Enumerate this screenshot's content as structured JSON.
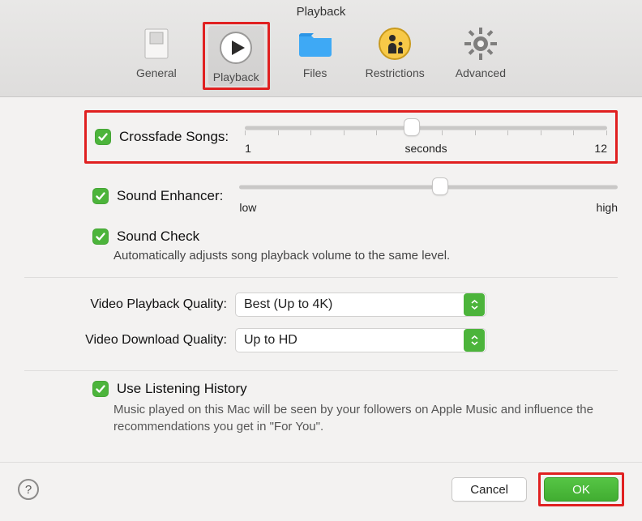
{
  "title": "Playback",
  "tabs": {
    "general": "General",
    "playback": "Playback",
    "files": "Files",
    "restrictions": "Restrictions",
    "advanced": "Advanced"
  },
  "crossfade": {
    "label": "Crossfade Songs:",
    "min": "1",
    "mid": "seconds",
    "max": "12",
    "position_percent": 46
  },
  "enhancer": {
    "label": "Sound Enhancer:",
    "low": "low",
    "high": "high",
    "position_percent": 53
  },
  "soundcheck": {
    "label": "Sound Check",
    "desc": "Automatically adjusts song playback volume to the same level."
  },
  "video": {
    "playback_label": "Video Playback Quality:",
    "playback_value": "Best (Up to 4K)",
    "download_label": "Video Download Quality:",
    "download_value": "Up to HD"
  },
  "history": {
    "label": "Use Listening History",
    "desc": "Music played on this Mac will be seen by your followers on Apple Music and influence the recommendations you get in \"For You\"."
  },
  "footer": {
    "cancel": "Cancel",
    "ok": "OK"
  }
}
